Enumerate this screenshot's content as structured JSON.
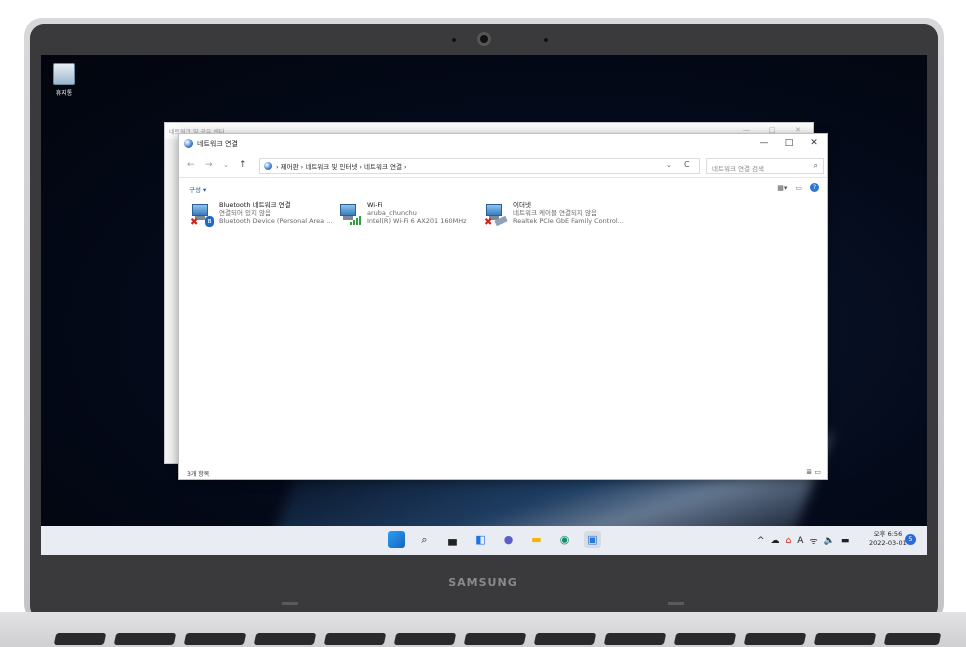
{
  "desktop": {
    "recycle_bin_label": "휴지통"
  },
  "back_window": {
    "title": "네트워크 및 공유 센터",
    "controls": [
      "—",
      "□",
      "✕"
    ]
  },
  "window": {
    "title": "네트워크 연결",
    "controls": {
      "minimize": "—",
      "maximize": "□",
      "close": "✕"
    },
    "nav": {
      "back": "←",
      "forward": "→",
      "recent": "⌄",
      "up": "↑"
    },
    "address": "›  제어판  ›  네트워크 및 인터넷  ›  네트워크 연결  ›",
    "address_dropdown": "⌄",
    "refresh": "C",
    "search_placeholder": "네트워크 연결 검색",
    "search_icon": "⌕",
    "organize_label": "구성 ▾",
    "view_icons": [
      "▦▾",
      "▭",
      "?"
    ],
    "items": [
      {
        "name": "Bluetooth 네트워크 연결",
        "status": "연결되어 있지 않음",
        "device": "Bluetooth Device (Personal Area ...",
        "icon": "bluetooth-network-icon",
        "badge": "✖"
      },
      {
        "name": "Wi-Fi",
        "status": "aruba_chunchu",
        "device": "Intel(R) Wi-Fi 6 AX201 160MHz",
        "icon": "wifi-network-icon",
        "badge": ""
      },
      {
        "name": "이더넷",
        "status": "네트워크 케이블 연결되지 않음",
        "device": "Realtek PCIe GbE Family Control...",
        "icon": "ethernet-network-icon",
        "badge": "✖"
      }
    ],
    "status_text": "3개 항목",
    "status_icons": "≣ ▭"
  },
  "taskbar": {
    "icons": [
      "start-icon",
      "search-icon",
      "task-view-icon",
      "widgets-icon",
      "chat-icon",
      "file-explorer-icon",
      "edge-icon",
      "network-connections-icon"
    ],
    "tray": [
      "^",
      "☁",
      "⌂",
      "A",
      "ᯤ",
      "🔈",
      "▬"
    ],
    "clock_time": "오후 6:56",
    "clock_date": "2022-03-01",
    "notification_count": "5"
  },
  "laptop": {
    "brand": "SAMSUNG"
  }
}
